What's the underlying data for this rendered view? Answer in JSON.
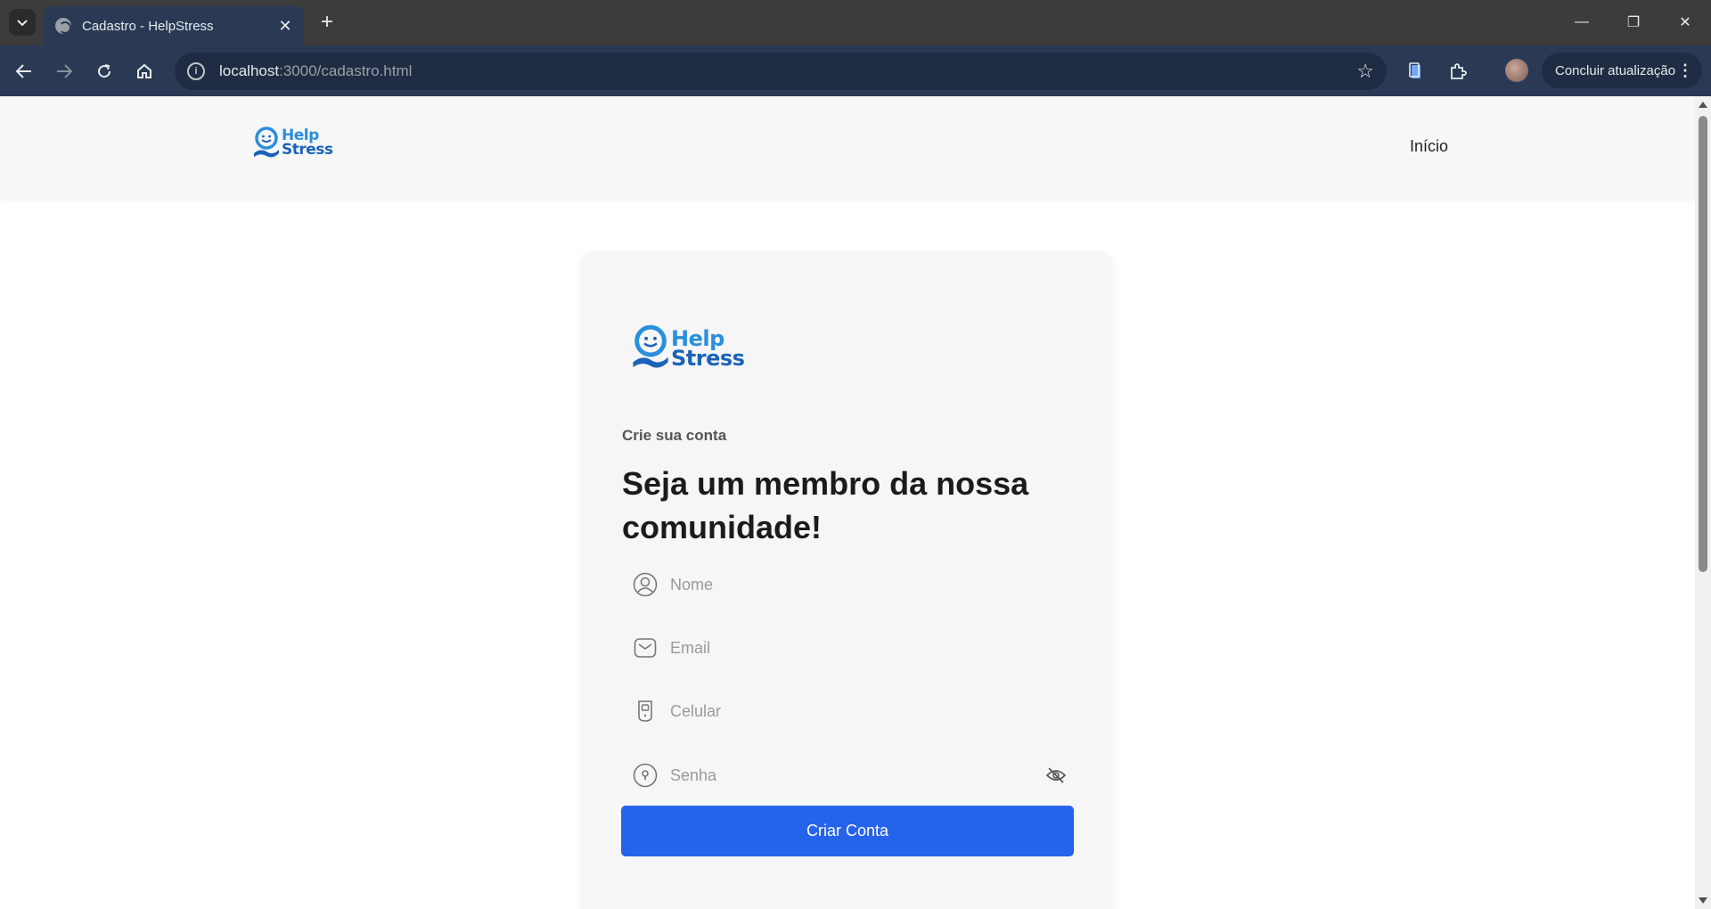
{
  "browser": {
    "tab_title": "Cadastro - HelpStress",
    "tab_close": "✕",
    "new_tab": "+",
    "url_host": "localhost",
    "url_path": ":3000/cadastro.html",
    "update_label": "Concluir atualização",
    "window_controls": {
      "minimize": "—",
      "restore": "❐",
      "close": "✕"
    }
  },
  "header": {
    "logo_help": "Help",
    "logo_stress": "Stress",
    "nav_home": "Início"
  },
  "card": {
    "logo_help": "Help",
    "logo_stress": "Stress",
    "subtitle": "Crie sua conta",
    "headline": "Seja um membro da nossa comunidade!"
  },
  "form": {
    "name_placeholder": "Nome",
    "email_placeholder": "Email",
    "phone_placeholder": "Celular",
    "password_placeholder": "Senha",
    "submit_label": "Criar Conta"
  },
  "colors": {
    "primary_button": "#2563eb",
    "logo_help": "#2a8fdc",
    "logo_stress": "#1b63b8",
    "browser_toolbar": "#2a3a55"
  }
}
